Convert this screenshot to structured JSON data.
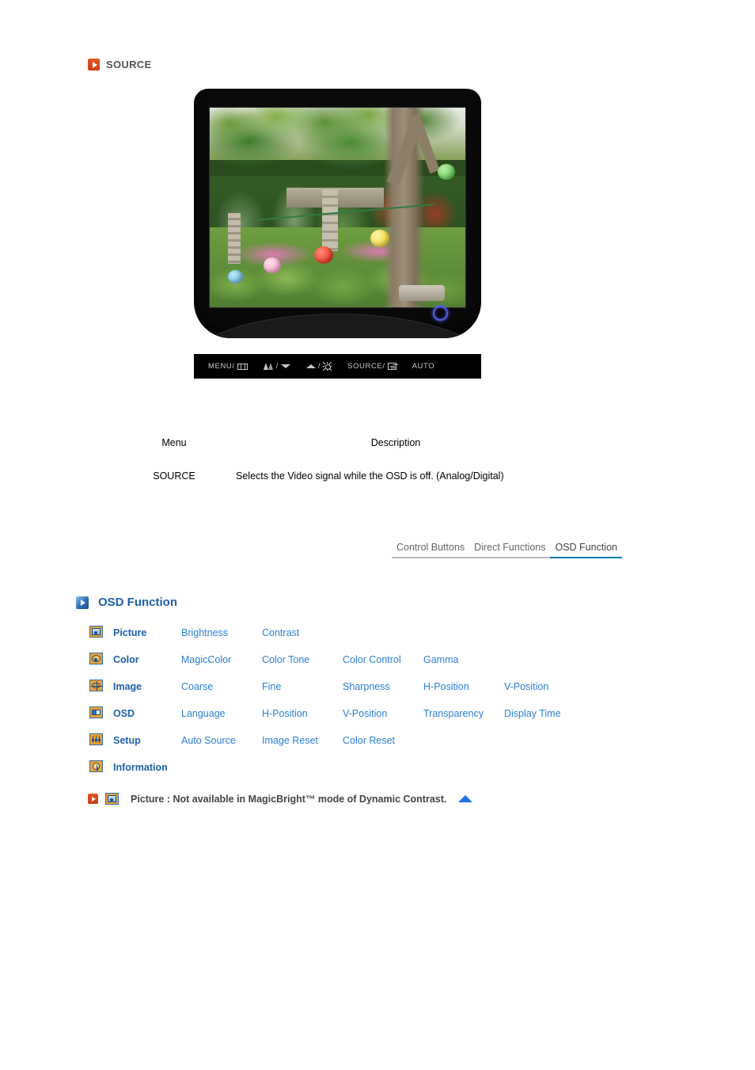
{
  "source_section": {
    "icon": "orange-arrow-bullet-icon",
    "title": "SOURCE"
  },
  "monitor": {
    "alt": "samsung-lcd-monitor-front-view",
    "power_led": "power-indicator-led",
    "screen_content": "garden-photo-with-paper-lanterns",
    "control_buttons": [
      {
        "name": "menu-button",
        "label": "MENU/",
        "icon": "osd-menu-icon"
      },
      {
        "name": "magicbright-down-button",
        "label": "",
        "icon": "magicbright-icon",
        "separator": "/",
        "icon2": "down-arrow-icon"
      },
      {
        "name": "up-brightness-button",
        "label": "",
        "icon": "up-arrow-icon",
        "separator": "/",
        "icon2": "brightness-sun-icon"
      },
      {
        "name": "source-enter-button",
        "label": "SOURCE/",
        "icon": "enter-icon"
      },
      {
        "name": "auto-button",
        "label": "AUTO",
        "icon": ""
      }
    ]
  },
  "description_table": {
    "headers": {
      "menu": "Menu",
      "description": "Description"
    },
    "rows": [
      {
        "menu": "SOURCE",
        "description": "Selects the Video signal while the OSD is off. (Analog/Digital)"
      }
    ]
  },
  "tabs": [
    {
      "label": "Control Buttons",
      "active": false
    },
    {
      "label": "Direct Functions",
      "active": false
    },
    {
      "label": "OSD Function",
      "active": true
    }
  ],
  "osd_section": {
    "icon": "blue-arrow-bullet-icon",
    "title": "OSD Function",
    "rows": [
      {
        "icon": "picture-icon",
        "category": "Picture",
        "items": [
          "Brightness",
          "Contrast"
        ]
      },
      {
        "icon": "color-palette-icon",
        "category": "Color",
        "items": [
          "MagicColor",
          "Color Tone",
          "Color Control",
          "Gamma"
        ]
      },
      {
        "icon": "image-icon",
        "category": "Image",
        "items": [
          "Coarse",
          "Fine",
          "Sharpness",
          "H-Position",
          "V-Position"
        ]
      },
      {
        "icon": "osd-icon",
        "category": "OSD",
        "items": [
          "Language",
          "H-Position",
          "V-Position",
          "Transparency",
          "Display Time"
        ]
      },
      {
        "icon": "setup-sliders-icon",
        "category": "Setup",
        "items": [
          "Auto Source",
          "Image Reset",
          "Color Reset"
        ]
      },
      {
        "icon": "information-clock-icon",
        "category": "Information",
        "items": []
      }
    ]
  },
  "footnote": {
    "bullet_icon": "orange-arrow-bullet-icon",
    "picture_icon": "picture-icon",
    "text": "Picture : Not available in MagicBright™ mode of Dynamic Contrast.",
    "top_arrow_icon": "back-to-top-arrow-icon"
  },
  "colors": {
    "orange_bullet": "#d94f20",
    "blue_bullet": "#2b6fb5",
    "heading_blue": "#1e5fa8",
    "link_blue": "#2b7fd6",
    "active_tab_underline": "#0f7ab0",
    "inactive_tab_underline": "#b9b9b9",
    "icon_orange": "#f0a22e",
    "top_arrow_blue": "#1a74e8"
  }
}
